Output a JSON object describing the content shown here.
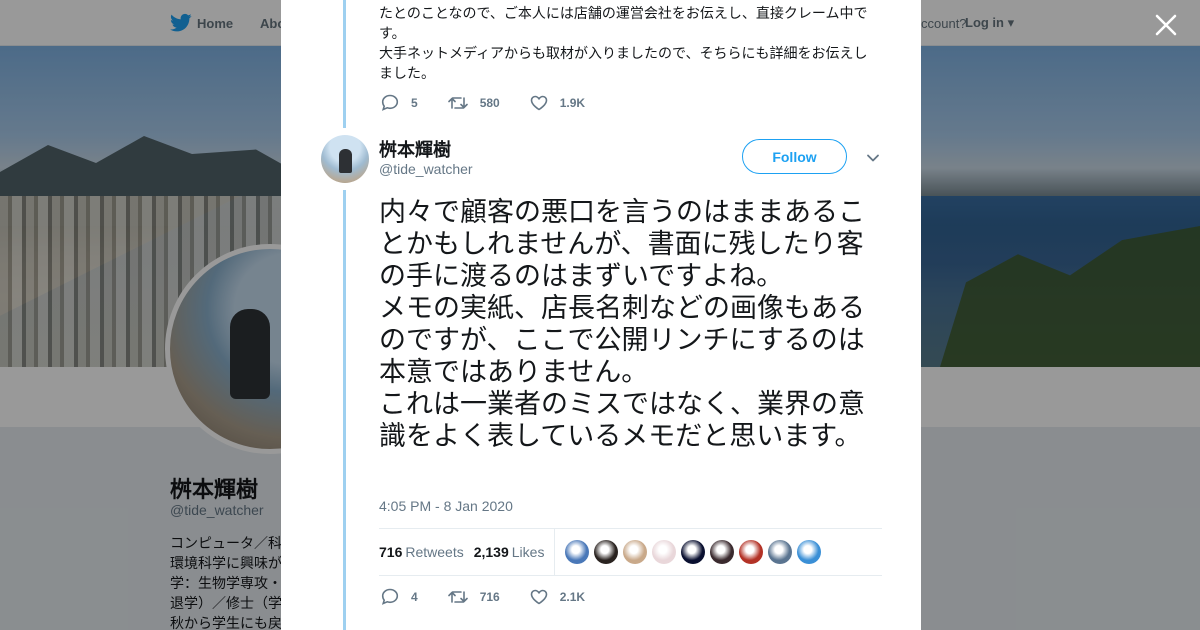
{
  "nav": {
    "home": "Home",
    "about": "Abo",
    "have_account": "ccount?",
    "login": "Log in"
  },
  "profile": {
    "name": "桝本輝樹",
    "handle": "@tide_watcher",
    "bio": "コンピュータ／科\n環境科学に興味が\n学：生物学専攻・\n退学）／修士（学\n秋から学生にも戻"
  },
  "previous_tweet": {
    "text": "たとのことなので、ご本人には店舗の運営会社をお伝えし、直接クレーム中です。\n大手ネットメディアからも取材が入りましたので、そちらにも詳細をお伝えしました。",
    "replies": "5",
    "retweets": "580",
    "likes": "1.9K"
  },
  "tweet": {
    "name": "桝本輝樹",
    "handle": "@tide_watcher",
    "follow_label": "Follow",
    "text": "内々で顧客の悪口を言うのはままあることかもしれませんが、書面に残したり客の手に渡るのはまずいですよね。\nメモの実紙、店長名刺などの画像もあるのですが、ここで公開リンチにするのは本意ではありません。\nこれは一業者のミスではなく、業界の意識をよく表しているメモだと思います。",
    "timestamp": "4:05 PM - 8 Jan 2020",
    "retweets_count": "716",
    "retweets_label": "Retweets",
    "likes_count": "2,139",
    "likes_label": "Likes",
    "replies": "4",
    "retweets": "716",
    "likes": "2.1K"
  },
  "likers": [
    {
      "color": "#4a78b8"
    },
    {
      "color": "#2a2320"
    },
    {
      "color": "#c9a98a"
    },
    {
      "color": "#e9d7da"
    },
    {
      "color": "#0a1030"
    },
    {
      "color": "#3a2a2e"
    },
    {
      "color": "#b33226"
    },
    {
      "color": "#5a7490"
    },
    {
      "color": "#3a8fd6"
    }
  ],
  "colors": {
    "accent": "#1da1f2",
    "thread_line": "#9ed0f0",
    "muted": "#657786"
  }
}
